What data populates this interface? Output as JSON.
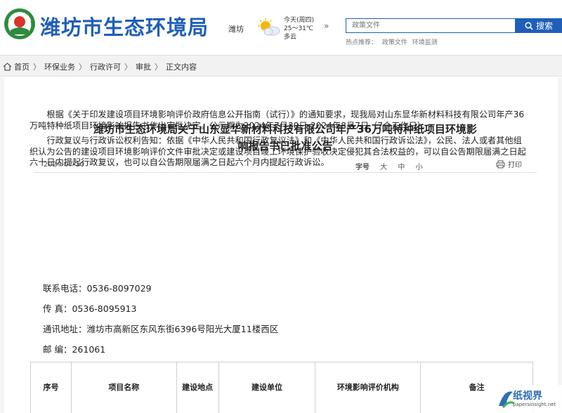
{
  "header": {
    "site_title": "潍坊市生态环境局",
    "city": "潍坊",
    "weather": {
      "line1": "今天(周四)",
      "line2": "25～31℃",
      "line3": "多云"
    },
    "more": "»",
    "search_placeholder": "政策文件",
    "search_button": "搜索",
    "hot_label": "热点推荐：",
    "hot_items": [
      "政策文件",
      "环境监测"
    ]
  },
  "breadcrumb": [
    "首页",
    "环保业务",
    "行政许可",
    "审批",
    "正文内容"
  ],
  "article": {
    "title_line1": "潍坊市生态环境局关于山东显华新材料科技有限公司年产36万吨特种纸项目环境影",
    "title_line2": "响报告书已批准公告",
    "date": "2024-07-30",
    "font_label": "字号",
    "font_sizes": [
      "大",
      "中",
      "小"
    ],
    "print": "打印",
    "paragraph1": "根据《关于印发建设项目环境影响评价政府信息公开指南（试行）》的通知要求，现我局对山东显华新材料科技有限公司年产36万吨特种纸项目环境影响报告书作出审批决定。公示期为2024年7月30日-2024年8月7日（7个工作日）。",
    "paragraph2": "行政复议与行政诉讼权利告知：依据《中华人民共和国行政复议法》和《中华人民共和国行政诉讼法》，公民、法人或者其他组织认为公告的建设项目环境影响评价文件审批决定或建设项目竣工环境保护验收决定侵犯其合法权益的，可以自公告期限届满之日起六十日内提起行政复议，也可以自公告期限届满之日起六个月内提起行政诉讼。",
    "phone": "联系电话：0536-8097029",
    "fax": "传 真：0536-8095913",
    "address": "通讯地址：潍坊市高新区东风东街6396号阳光大厦11楼西区",
    "postcode": "邮 编：261061"
  },
  "table": {
    "headers": [
      "序号",
      "项目名称",
      "建设地点",
      "建设单位",
      "环境影响评价机构",
      "备注"
    ]
  },
  "watermark": {
    "text": "纸视界",
    "sub": "papersinsight.net"
  },
  "colors": {
    "brand": "#1f5fb8"
  }
}
